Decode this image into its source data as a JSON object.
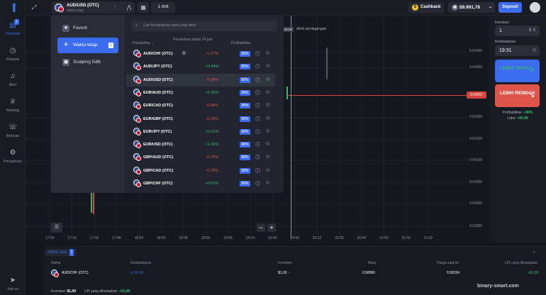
{
  "nav": {
    "items": [
      {
        "label": "Portofolio",
        "icon": "briefcase-icon",
        "badge": "1"
      },
      {
        "label": "Riwayat",
        "icon": "history-icon"
      },
      {
        "label": "Alert",
        "icon": "bell-icon"
      },
      {
        "label": "Ranking",
        "icon": "trophy-icon"
      },
      {
        "label": "Bantuan",
        "icon": "support-icon"
      },
      {
        "label": "Pengaturan",
        "icon": "gear-icon"
      }
    ],
    "join": "Join us"
  },
  "header": {
    "asset_name": "AUD/USD (OTC)",
    "asset_sub": "Waktu tetap",
    "timeframe": "1 mnt",
    "cashback": "Cashback",
    "balance": "$9.991,78",
    "deposit": "Deposit"
  },
  "chart": {
    "end_label": "01:00",
    "end_text": "Akhir perdagangan",
    "price_tag": "0.64257",
    "y_ticks": [
      "0.64350",
      "0.64300",
      "0.64200",
      "0.64150",
      "0.64100",
      "0.64050",
      "0.64000",
      "0.63950"
    ],
    "x_ticks": [
      "17:00",
      "17:16",
      "17:32",
      "17:48",
      "18:04",
      "18:20",
      "18:36",
      "18:52",
      "19:08",
      "19:24",
      "19:40",
      "19:56",
      "20:12",
      "20:28",
      "20:44",
      "21:00",
      "21:16",
      "21:32"
    ]
  },
  "panel": {
    "search_placeholder": "Cari berdasarkan nama atau tiket",
    "categories": [
      {
        "label": "Favorit",
        "icon": "star-icon"
      },
      {
        "label": "Waktu tetap",
        "icon": "clock-icon",
        "badge": "1"
      },
      {
        "label": "Scalping 5dtk",
        "icon": "bolt-icon"
      }
    ],
    "col_popular": "Popularitas",
    "col_change": "Perubahan dalam 24 jam",
    "col_profit": "Profitabilitas",
    "rows": [
      {
        "name": "AUD/CHF (OTC)",
        "badge": "1",
        "change": "-1.27%",
        "dir": "down",
        "profit": "88%"
      },
      {
        "name": "AUD/JPY (OTC)",
        "change": "+0.44%",
        "dir": "up",
        "profit": "88%"
      },
      {
        "name": "AUD/USD (OTC)",
        "change": "-0.08%",
        "dir": "down",
        "profit": "88%"
      },
      {
        "name": "EUR/AUD (OTC)",
        "change": "+2.36%",
        "dir": "up",
        "profit": "88%"
      },
      {
        "name": "EUR/CAD (OTC)",
        "change": "-0.88%",
        "dir": "down",
        "profit": "88%"
      },
      {
        "name": "EUR/GBP (OTC)",
        "change": "-0.19%",
        "dir": "down",
        "profit": "88%"
      },
      {
        "name": "EUR/JPY (OTC)",
        "change": "+0.31%",
        "dir": "up",
        "profit": "88%"
      },
      {
        "name": "EUR/USD (OTC)",
        "change": "+1.99%",
        "dir": "up",
        "profit": "88%"
      },
      {
        "name": "GBP/AUD (OTC)",
        "change": "-0.75%",
        "dir": "down",
        "profit": "88%"
      },
      {
        "name": "GBP/CAD (OTC)",
        "change": "-0.75%",
        "dir": "down",
        "profit": "88%"
      },
      {
        "name": "GBP/CHF (OTC)",
        "change": "+0.63%",
        "dir": "up",
        "profit": "88%"
      }
    ]
  },
  "trade": {
    "inv_label": "Investasi",
    "inv_value": "1",
    "inv_unit": "$",
    "exp_label": "Kedaluwarsa",
    "exp_value": "19:31",
    "higher": "LEBIH TINGGI",
    "lower": "LEBIH RENDAH",
    "profit_label": "Profitabilitas:",
    "profit_value": "+88%",
    "payout_label": "Laba:",
    "payout_value": "+$0,88"
  },
  "bottom": {
    "tab": "Waktu tetap",
    "tab_badge": "1",
    "headers": [
      "Nama",
      "Kedaluwarsa",
      "Investasi",
      "Buka",
      "Harga saat ini",
      "L/R yang diharapkan"
    ],
    "row": {
      "name": "AUD/CHF (OTC)",
      "exp": "00:03",
      "inv": "$1,00",
      "open": "0.58060",
      "current": "0.58154",
      "pnl": "+$1,88"
    },
    "footer_inv_label": "Investasi:",
    "footer_inv": "$1,00",
    "footer_pnl_label": "L/R yang diharapkan:",
    "footer_pnl": "+$1,88"
  },
  "watermark": "binary-smart.com"
}
